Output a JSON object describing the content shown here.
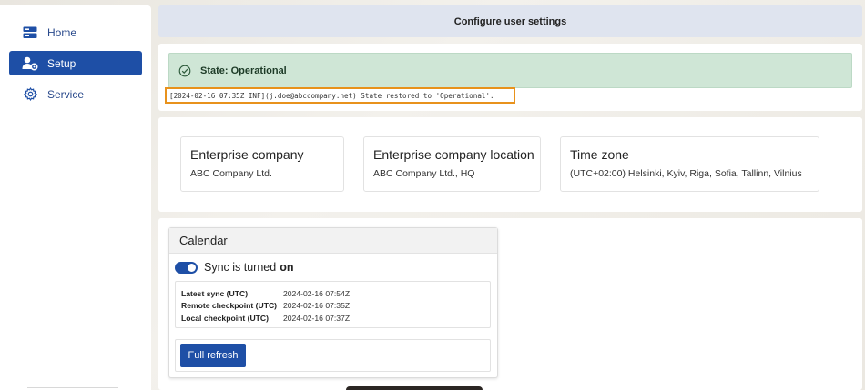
{
  "sidebar": {
    "items": [
      {
        "label": "Home",
        "icon": "server-icon",
        "active": false
      },
      {
        "label": "Setup",
        "icon": "user-gear-icon",
        "active": true
      },
      {
        "label": "Service",
        "icon": "gear-icon",
        "active": false
      }
    ]
  },
  "header": {
    "title": "Configure user settings"
  },
  "state": {
    "label": "State: Operational",
    "log": "[2024-02-16 07:35Z INF](j.doe@abccompany.net) State restored to 'Operational'."
  },
  "company": {
    "enterprise_title": "Enterprise company",
    "enterprise_value": "ABC Company Ltd.",
    "location_title": "Enterprise company location",
    "location_value": "ABC Company Ltd., HQ",
    "timezone_title": "Time zone",
    "timezone_value": "(UTC+02:00) Helsinki, Kyiv, Riga, Sofia, Tallinn, Vilnius"
  },
  "calendar": {
    "title": "Calendar",
    "sync_text": "Sync is turned",
    "sync_state": "on",
    "rows": [
      {
        "key": "Latest sync (UTC)",
        "value": "2024-02-16 07:54Z"
      },
      {
        "key": "Remote checkpoint (UTC)",
        "value": "2024-02-16 07:35Z"
      },
      {
        "key": "Local checkpoint (UTC)",
        "value": "2024-02-16 07:37Z"
      }
    ],
    "refresh_label": "Full refresh"
  },
  "colors": {
    "accent": "#1e4fa6",
    "success_bg": "#cfe6d6",
    "highlight": "#e8921c",
    "header_bg": "#dfe4ef"
  }
}
